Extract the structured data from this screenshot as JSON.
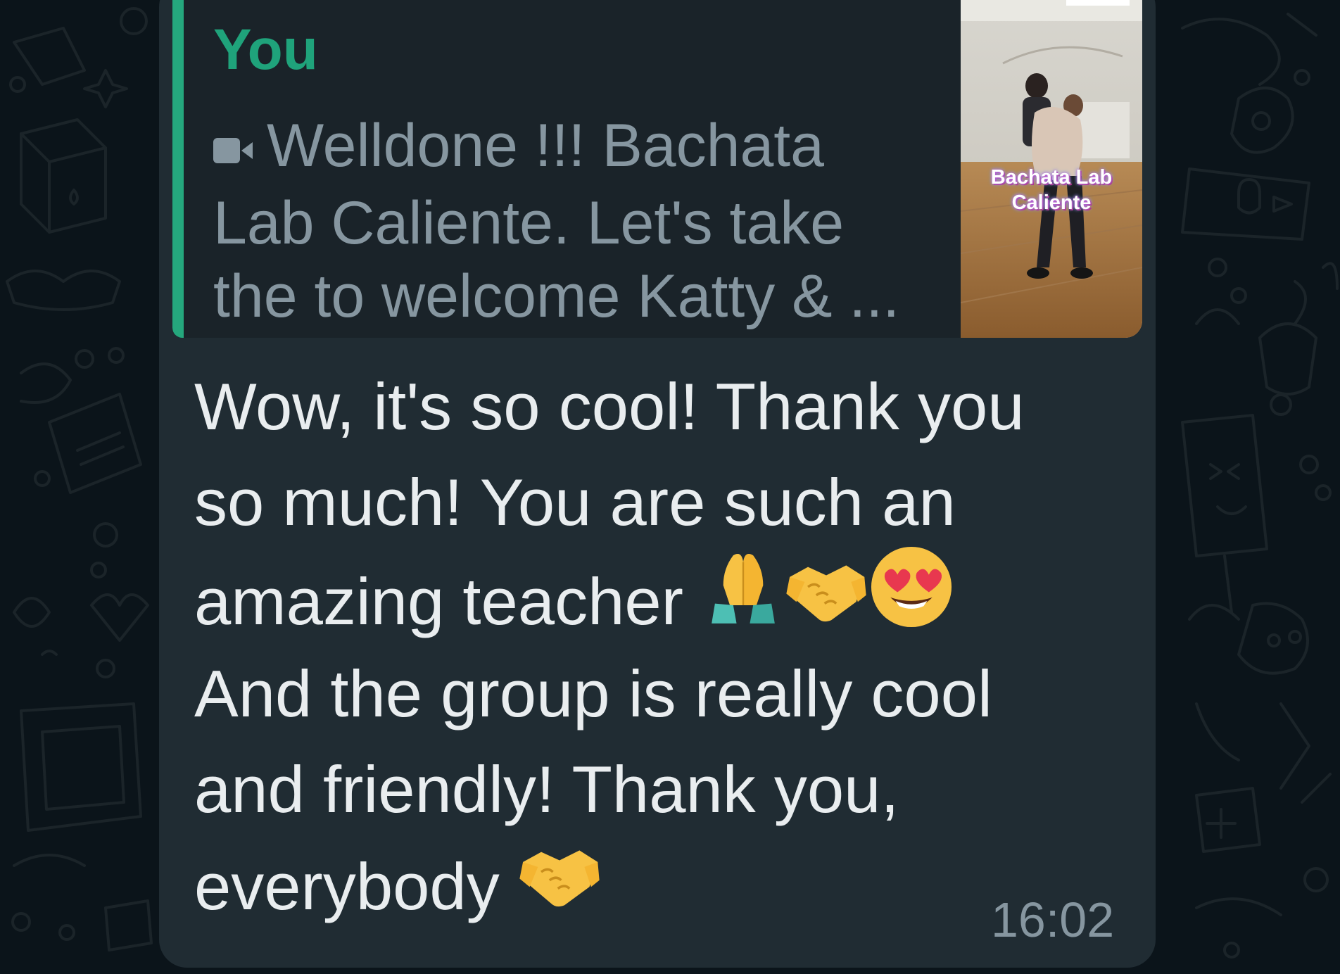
{
  "quoted_message": {
    "author": "You",
    "media_type_icon": "video-camera-icon",
    "text": "Welldone !!! Bachata Lab Caliente. Let's take the to welcome Katty & ...",
    "text_lines": [
      "Welldone !!! Bachata",
      "Lab Caliente. Let's take",
      "the to welcome Katty & ..."
    ],
    "thumbnail_caption_line1": "Bachata Lab",
    "thumbnail_caption_line2": "Caliente",
    "accent_color": "#25a77d"
  },
  "message": {
    "line1": "Wow, it's so cool! Thank you",
    "line2": "so much!  You are such an",
    "line3": "amazing teacher",
    "line3_emojis": [
      "folded-hands-emoji",
      "handshake-emoji",
      "heart-eyes-emoji"
    ],
    "line4": "And the group is really cool",
    "line5": "and friendly! Thank you,",
    "line6": "everybody",
    "line6_emojis": [
      "handshake-emoji"
    ],
    "time": "16:02"
  },
  "colors": {
    "background": "#0b141a",
    "bubble": "#202c33",
    "text": "#e9edef",
    "muted": "#8696a0"
  }
}
